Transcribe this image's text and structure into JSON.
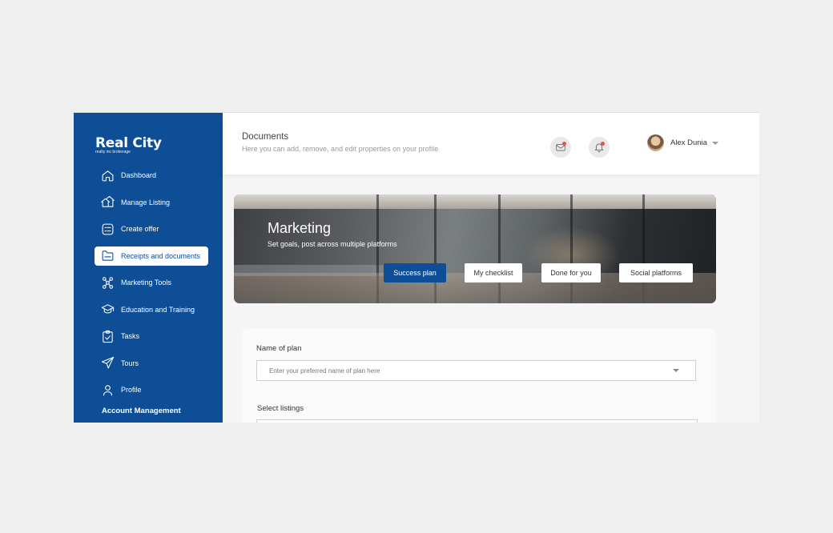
{
  "brand": {
    "name": "Real City",
    "tagline": "realty inc brokerage"
  },
  "sidebar": {
    "items": [
      {
        "label": "Dashboard",
        "icon": "home-icon"
      },
      {
        "label": "Manage Listing",
        "icon": "houses-icon"
      },
      {
        "label": "Create offer",
        "icon": "offer-icon"
      },
      {
        "label": "Receipts and documents",
        "icon": "folder-icon",
        "active": true
      },
      {
        "label": "Marketing Tools",
        "icon": "network-icon"
      },
      {
        "label": "Education and Training",
        "icon": "graduation-cap-icon"
      },
      {
        "label": "Tasks",
        "icon": "clipboard-check-icon"
      },
      {
        "label": "Tours",
        "icon": "paper-plane-icon"
      },
      {
        "label": "Profile",
        "icon": "user-icon"
      }
    ],
    "account_heading": "Account Management"
  },
  "header": {
    "title": "Documents",
    "subtitle": "Here you can add, remove, and edit properties on your profile",
    "user_name": "Alex Dunia"
  },
  "banner": {
    "title": "Marketing",
    "subtitle": "Set goals, post across multiple platforms",
    "buttons": [
      "Success plan",
      "My checklist",
      "Done for you",
      "Social platforms"
    ]
  },
  "form": {
    "plan_label": "Name of plan",
    "plan_placeholder": "Enter your preferred name of plan here",
    "listings_label": "Select listings"
  },
  "colors": {
    "primary": "#0d4e96",
    "notification": "#e2534a"
  }
}
